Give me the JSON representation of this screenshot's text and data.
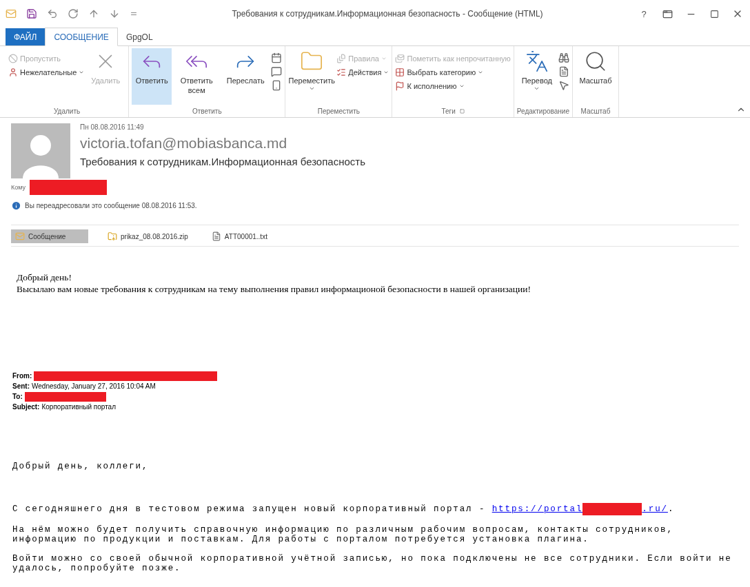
{
  "window": {
    "title": "Требования к сотрудникам.Информационная безопасность - Сообщение (HTML)",
    "help": "?"
  },
  "tabs": [
    {
      "label": "ФАЙЛ",
      "kind": "file",
      "selected": false
    },
    {
      "label": "СООБЩЕНИЕ",
      "kind": "tab",
      "selected": true
    },
    {
      "label": "GpgOL",
      "kind": "tab",
      "selected": false
    }
  ],
  "ribbon_groups": [
    {
      "label": "Удалить",
      "items": [
        {
          "kind": "stack",
          "items": [
            {
              "label": "Пропустить",
              "disabled": true,
              "dropdown": false
            },
            {
              "label": "Нежелательные",
              "disabled": false,
              "dropdown": true
            }
          ]
        },
        {
          "kind": "large",
          "label": "Удалить",
          "disabled": true,
          "selected": false,
          "dropdown": false
        }
      ]
    },
    {
      "label": "Ответить",
      "items": [
        {
          "kind": "large",
          "label": "Ответить",
          "disabled": false,
          "selected": true,
          "dropdown": false
        },
        {
          "kind": "large",
          "label": "Ответить всем",
          "disabled": false,
          "selected": false,
          "dropdown": false
        },
        {
          "kind": "large",
          "label": "Переслать",
          "disabled": false,
          "selected": false,
          "dropdown": false
        },
        {
          "kind": "icons"
        }
      ]
    },
    {
      "label": "Переместить",
      "items": [
        {
          "kind": "large",
          "label": "Переместить",
          "disabled": false,
          "selected": false,
          "dropdown": true
        },
        {
          "kind": "stack",
          "items": [
            {
              "label": "Правила",
              "disabled": true,
              "dropdown": true
            },
            {
              "label": "Действия",
              "disabled": false,
              "dropdown": true
            }
          ]
        }
      ]
    },
    {
      "label": "Теги",
      "launcher": true,
      "items": [
        {
          "kind": "stack",
          "items": [
            {
              "label": "Пометить как непрочитанную",
              "disabled": true,
              "dropdown": false
            },
            {
              "label": "Выбрать категорию",
              "disabled": false,
              "dropdown": true
            },
            {
              "label": "К исполнению",
              "disabled": false,
              "dropdown": true
            }
          ]
        }
      ]
    },
    {
      "label": "Редактирование",
      "items": [
        {
          "kind": "large",
          "label": "Перевод",
          "disabled": false,
          "selected": false,
          "dropdown": true
        },
        {
          "kind": "icons"
        }
      ]
    },
    {
      "label": "Масштаб",
      "items": [
        {
          "kind": "large",
          "label": "Масштаб",
          "disabled": false,
          "selected": false,
          "dropdown": false
        }
      ]
    }
  ],
  "header": {
    "date": "Пн 08.08.2016 11:49",
    "sender": "victoria.tofan@mobiasbanca.md",
    "subject": "Требования к сотрудникам.Информационная безопасность",
    "to_label": "Кому",
    "to_redacted": true,
    "info": "Вы переадресовали это сообщение 08.08.2016 11:53."
  },
  "attachments": [
    {
      "name": "Сообщение",
      "kind": "message",
      "selected": true
    },
    {
      "name": "prikaz_08.08.2016.zip",
      "kind": "zip",
      "selected": false
    },
    {
      "name": "ATT00001..txt",
      "kind": "text",
      "selected": false
    }
  ],
  "body": {
    "greeting": "Добрый день!",
    "message": "Высылаю вам новые требования к сотрудникам на тему выполнения правил информационой безопасности в нашей организации!",
    "forwarded": [
      {
        "label": "From:",
        "redacted": true
      },
      {
        "label": "Sent:",
        "value": "Wednesday, January 27, 2016 10:04 AM",
        "redacted": false
      },
      {
        "label": "To:",
        "redacted": true
      },
      {
        "label": "Subject:",
        "value": "Корпоративный портал",
        "redacted": false
      }
    ],
    "salutation": "Добрый день, коллеги,",
    "portal_text": "С сегодняшнего дня в тестовом режима запущен новый корпоративный портал -",
    "link_start": "https://portal",
    "link_redacted": true,
    "link_end": ".ru/",
    "link_after": ".",
    "paragraphs": [
      "На нём можно будет получить справочную информацию по различным рабочим вопросам, контакты сотрудников,\nинформацию по продукции и поставкам. Для работы с порталом потребуется установка плагина.",
      "Войти можно со своей обычной корпоративной учётной записью, но пока подключены не все сотрудники. Если войти не\nудалось, попробуйте позже."
    ]
  }
}
